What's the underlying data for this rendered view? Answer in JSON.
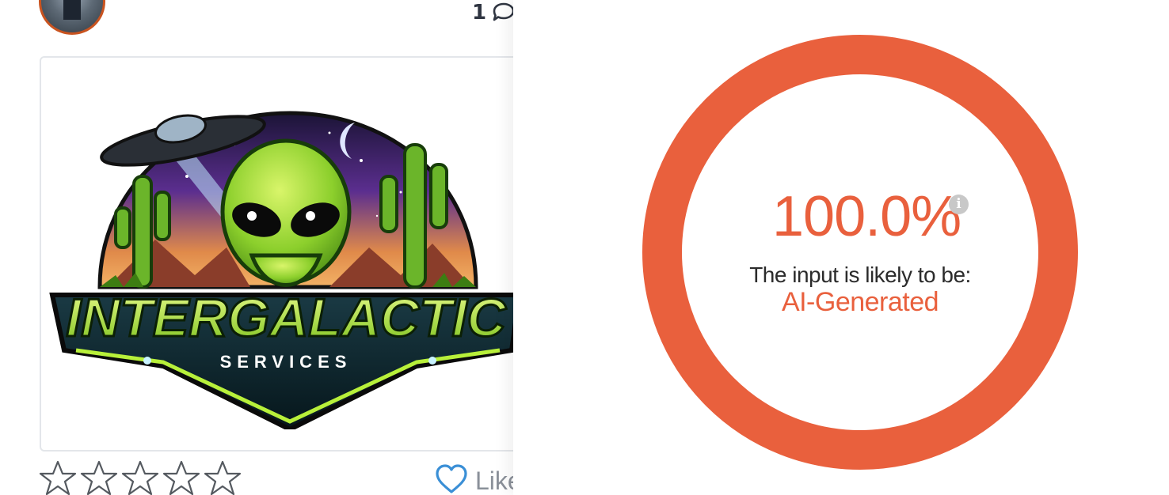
{
  "post": {
    "comment_count": "1",
    "like_label": "Like",
    "rating_stars": 0,
    "rating_max": 5
  },
  "image": {
    "headline": "INTERGALACTIC",
    "subline": "SERVICES"
  },
  "detector": {
    "score": "100.0%",
    "score_fraction": 1.0,
    "prefix": "The input is likely to be:",
    "verdict": "AI-Generated",
    "info_glyph": "i",
    "accent_color": "#e9603d"
  },
  "colors": {
    "avatar_border": "#c9531f",
    "like_icon": "#3a8fd6",
    "text_dark": "#2b2b2b"
  },
  "icons": [
    "avatar",
    "comment-icon",
    "star-icon",
    "heart-icon",
    "info-icon"
  ]
}
